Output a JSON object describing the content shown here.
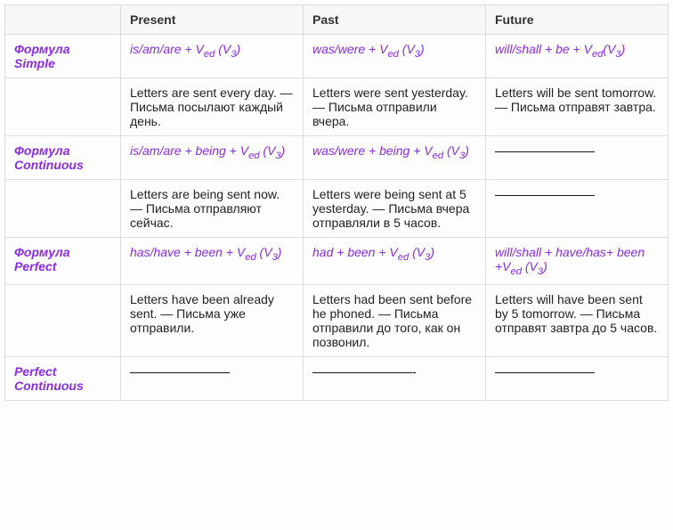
{
  "headers": {
    "col1": "",
    "present": "Present",
    "past": "Past",
    "future": "Future"
  },
  "rows": {
    "simple_label": "Формула Simple",
    "simple_present_formula_pre": "is/am/are + V",
    "simple_present_formula_sub": "ed",
    "simple_present_formula_post": " (V",
    "simple_present_formula_sub2": "3",
    "simple_present_formula_end": ")",
    "simple_past_formula_pre": "was/were + V",
    "simple_past_formula_sub": "ed",
    "simple_past_formula_post": " (V",
    "simple_past_formula_sub2": "3",
    "simple_past_formula_end": ")",
    "simple_future_formula_pre": "will/shall + be + V",
    "simple_future_formula_sub": "ed",
    "simple_future_formula_post": "(V",
    "simple_future_formula_sub2": "3",
    "simple_future_formula_end": ")",
    "simple_present_example": " Letters are sent every day. — Письма посылают каждый день.",
    "simple_past_example": " Letters were sent yesterday. — Письма отправили вчера.",
    "simple_future_example": " Letters will be sent tomorrow. — Письма отправят завтра.",
    "continuous_label": "Формула Continuous",
    "continuous_present_formula_pre": "is/am/are + being + V",
    "continuous_present_formula_sub": "ed",
    "continuous_present_formula_post": " (V",
    "continuous_present_formula_sub2": "3",
    "continuous_present_formula_end": ")",
    "continuous_past_formula_pre": "was/were + being + V",
    "continuous_past_formula_sub": "ed",
    "continuous_past_formula_post": " (V",
    "continuous_past_formula_sub2": "3",
    "continuous_past_formula_end": ")",
    "continuous_future_formula": "————————",
    "continuous_present_example": " Letters are being sent now. — Письма отправляют сейчас.",
    "continuous_past_example": " Letters were being sent at 5 yesterday. — Письма вчера отправляли в 5 часов.",
    "continuous_future_example": "————————",
    "perfect_label": "Формула Perfect",
    "perfect_present_formula_pre": "has/have + been + V",
    "perfect_present_formula_sub": "ed",
    "perfect_present_formula_post": " (V",
    "perfect_present_formula_sub2": "3",
    "perfect_present_formula_end": ")",
    "perfect_past_formula_pre": "had + been + V",
    "perfect_past_formula_sub": "ed",
    "perfect_past_formula_post": " (V",
    "perfect_past_formula_sub2": "3",
    "perfect_past_formula_end": ")",
    "perfect_future_formula_pre": " will/shall + have/has+ been +V",
    "perfect_future_formula_sub": "ed",
    "perfect_future_formula_post": " (V",
    "perfect_future_formula_sub2": "3",
    "perfect_future_formula_end": ")",
    "perfect_present_example": "  Letters have been already sent. — Письма уже отправили.",
    "perfect_past_example": " Letters had been sent before he phoned. — Письма отправили до того, как он позвонил.",
    "perfect_future_example": "  Letters will have been sent by 5 tomorrow. — Письма отправят завтра до 5 часов.",
    "perfcont_label": "Perfect Continuous",
    "perfcont_present": "————————",
    "perfcont_past": "————————-",
    "perfcont_future": "————————"
  }
}
